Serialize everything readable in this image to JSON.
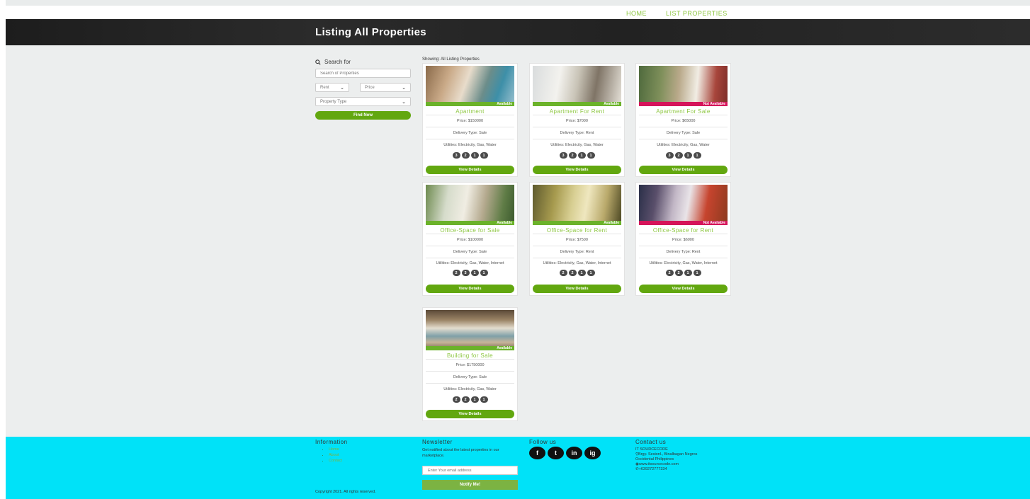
{
  "nav": {
    "home": "HOME",
    "list": "LIST PROPERTIES"
  },
  "header": {
    "title": "Listing All Properties"
  },
  "search": {
    "title": "Search for",
    "placeholder": "Search of Properties",
    "rent": "Rent",
    "price": "Price",
    "type": "Property Type",
    "button": "Find Now"
  },
  "showing": "Showing: All Listing Properties",
  "cards": [
    {
      "title": "Apartment",
      "badge": "Available",
      "price": "Price: $150000",
      "delivery": "Delivery Type: Sale",
      "utilities": "Utilities: Electricity, Gas, Water",
      "dots": [
        "3",
        "2",
        "1",
        "1"
      ],
      "button": "View Details"
    },
    {
      "title": "Apartment For Rent",
      "badge": "Available",
      "price": "Price: $7000",
      "delivery": "Delivery Type: Rent",
      "utilities": "Utilities: Electricity, Gas, Water",
      "dots": [
        "3",
        "2",
        "1",
        "1"
      ],
      "button": "View Details"
    },
    {
      "title": "Apartment For Sale",
      "badge": "Not Available",
      "price": "Price: $65000",
      "delivery": "Delivery Type: Sale",
      "utilities": "Utilities: Electricity, Gas, Water",
      "dots": [
        "3",
        "2",
        "1",
        "1"
      ],
      "button": "View Details"
    },
    {
      "title": "Office-Space for Sale",
      "badge": "Available",
      "price": "Price: $100000",
      "delivery": "Delivery Type: Sale",
      "utilities": "Utilities: Electricity, Gas, Water, Internet",
      "dots": [
        "2",
        "3",
        "1",
        "1"
      ],
      "button": "View Details"
    },
    {
      "title": "Office-Space for Rent",
      "badge": "Available",
      "price": "Price: $7500",
      "delivery": "Delivery Type: Rent",
      "utilities": "Utilities: Electricity, Gas, Water, Internet",
      "dots": [
        "2",
        "2",
        "1",
        "1"
      ],
      "button": "View Details"
    },
    {
      "title": "Office-Space for Rent",
      "badge": "Not Available",
      "price": "Price: $6000",
      "delivery": "Delivery Type: Rent",
      "utilities": "Utilities: Electricity, Gas, Water, Internet",
      "dots": [
        "2",
        "2",
        "1",
        "1"
      ],
      "button": "View Details"
    },
    {
      "title": "Building for Sale",
      "badge": "Available",
      "price": "Price: $1750000",
      "delivery": "Delivery Type: Sale",
      "utilities": "Utilities: Electricity, Gas, Water",
      "dots": [
        "2",
        "2",
        "1",
        "1"
      ],
      "button": "View Details"
    }
  ],
  "footer": {
    "info_title": "Information",
    "info_items": [
      "Home",
      "About",
      "Contact"
    ],
    "newsletter_title": "Newsletter",
    "newsletter_text": "Get notified about the latest properties in our marketplace.",
    "email_placeholder": "Enter Your email address",
    "notify": "Notify Me!",
    "follow_title": "Follow us",
    "social": [
      "f",
      "t",
      "in",
      "ig"
    ],
    "contact_title": "Contact us",
    "contact_lines": [
      "IT SOURCECODE",
      "Brgy. Sesionl., Binalbagan Negros",
      "Occidental Philippines",
      "www.itsourcecode.com",
      "+639272777334"
    ],
    "copyright": "Copyright 2021. All rights reserved."
  },
  "colors": {
    "accent": "#62a70f",
    "title_green": "#8cc63f",
    "footer_bg": "#00e2f8",
    "not_available": "#d5145a"
  }
}
